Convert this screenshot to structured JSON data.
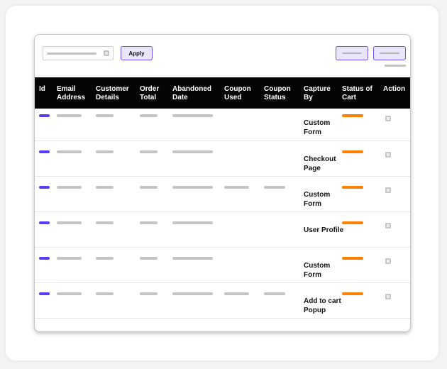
{
  "toolbar": {
    "search_placeholder": "",
    "apply_label": "Apply"
  },
  "colors": {
    "accent": "#5b3cf5",
    "status": "#ff8000",
    "header_bg": "#050505"
  },
  "table": {
    "columns": [
      {
        "key": "id",
        "label": "Id"
      },
      {
        "key": "email",
        "label": "Email Address"
      },
      {
        "key": "customer",
        "label": "Customer Details"
      },
      {
        "key": "total",
        "label": "Order Total"
      },
      {
        "key": "date",
        "label": "Abandoned Date"
      },
      {
        "key": "coupon_used",
        "label": "Coupon Used"
      },
      {
        "key": "coupon_status",
        "label": "Coupon Status"
      },
      {
        "key": "capture",
        "label": "Capture By"
      },
      {
        "key": "status",
        "label": "Status of Cart"
      },
      {
        "key": "action",
        "label": "Action"
      }
    ],
    "rows": [
      {
        "capture_by": "Custom Form",
        "has_coupon": false
      },
      {
        "capture_by": "Checkout Page",
        "has_coupon": false
      },
      {
        "capture_by": "Custom Form",
        "has_coupon": true
      },
      {
        "capture_by": "User Profile",
        "has_coupon": false
      },
      {
        "capture_by": "Custom Form",
        "has_coupon": false
      },
      {
        "capture_by": "Add to cart Popup",
        "has_coupon": true
      }
    ]
  }
}
